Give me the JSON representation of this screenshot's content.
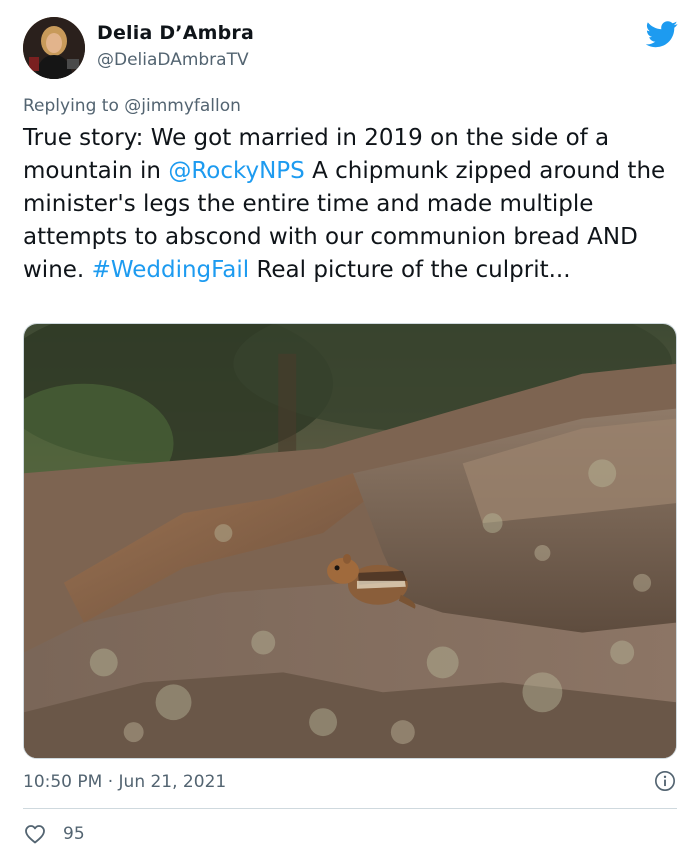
{
  "author": {
    "display_name": "Delia D’Ambra",
    "handle": "@DeliaDAmbraTV"
  },
  "reply": {
    "prefix": "Replying to ",
    "mention": "@jimmyfallon"
  },
  "tweet": {
    "part1": "True story: We got married in 2019 on the side of a mountain in ",
    "mention": "@RockyNPS",
    "part2": " A chipmunk zipped around the minister's legs the entire time and made multiple attempts to abscond with our communion bread AND wine. ",
    "hashtag": "#WeddingFail",
    "part3": " Real picture of the culprit..."
  },
  "meta": {
    "timestamp": "10:50 PM · Jun 21, 2021",
    "like_count": "95"
  },
  "icons": {
    "brand": "twitter-bird-icon",
    "info": "info-icon",
    "like": "heart-icon"
  },
  "colors": {
    "accent": "#1d9bf0",
    "muted": "#536471",
    "text": "#0f1419"
  }
}
